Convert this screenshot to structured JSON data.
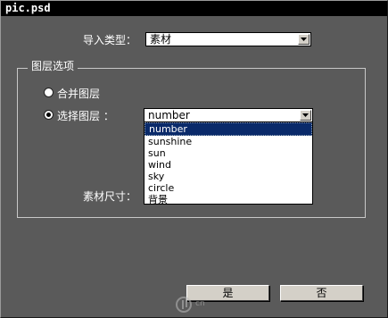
{
  "window": {
    "title": "pic.psd"
  },
  "import_type": {
    "label": "导入类型：",
    "value": "素材"
  },
  "layer_options": {
    "title": "图层选项",
    "merge_label": "合并图层",
    "select_label": "选择图层 ：",
    "select_value": "number",
    "selected_radio": "select",
    "dropdown_options": [
      "number",
      "sunshine",
      "sun",
      "wind",
      "sky",
      "circle",
      "背景"
    ],
    "dropdown_selected": "number",
    "size_label": "素材尺寸："
  },
  "buttons": {
    "yes": "是",
    "no": "否"
  },
  "watermark": {
    "text": "cn"
  },
  "colors": {
    "background": "#5a5a5a",
    "titlebar": "#000000",
    "highlight": "#0a2a6a"
  }
}
